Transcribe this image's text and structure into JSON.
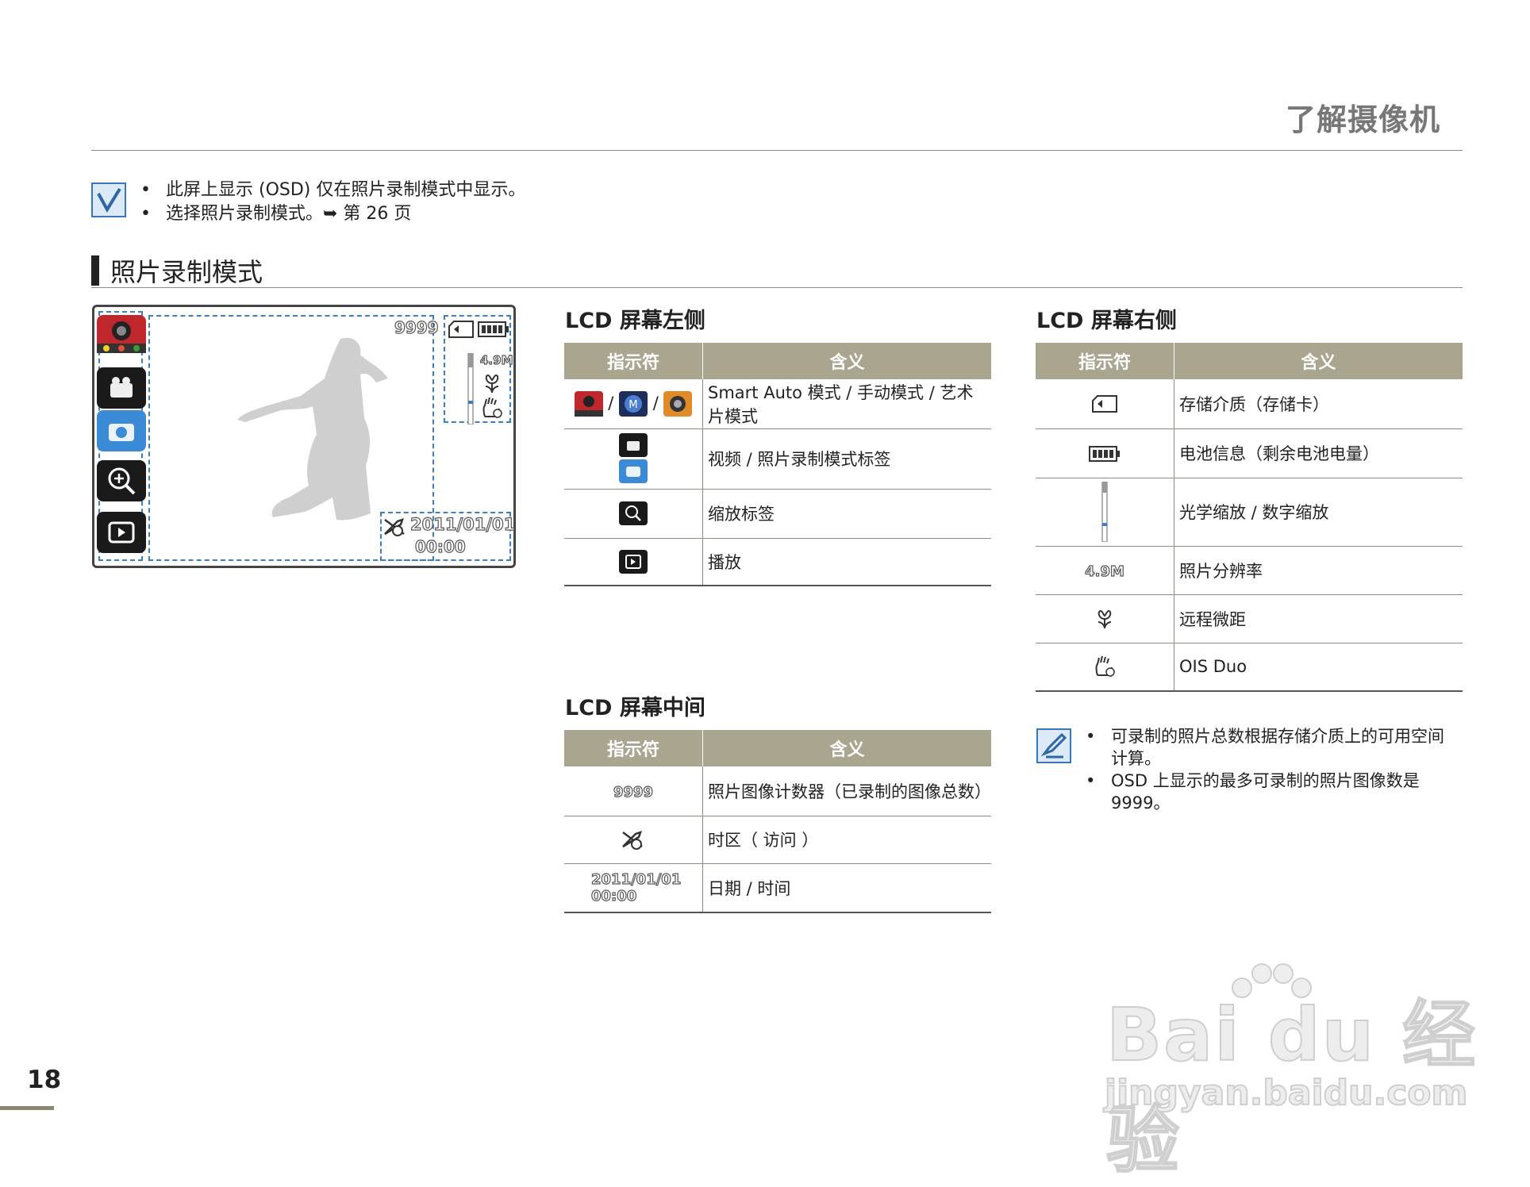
{
  "chapter_title": "了解摄像机",
  "notes": [
    "此屏上显示 (OSD) 仅在照片录制模式中显示。",
    "选择照片录制模式。➥ 第 26 页"
  ],
  "section_title": "照片录制模式",
  "lcd_preview": {
    "counter": "9999",
    "resolution": "4.9M",
    "date": "2011/01/01",
    "time": "00:00"
  },
  "left_table": {
    "title": "LCD 屏幕左侧",
    "col_indicator": "指示符",
    "col_meaning": "含义",
    "rows": [
      {
        "meaning": "Smart Auto 模式 / 手动模式 / 艺术片模式",
        "sep": "/"
      },
      {
        "meaning": "视频 / 照片录制模式标签"
      },
      {
        "meaning": "缩放标签"
      },
      {
        "meaning": "播放"
      }
    ]
  },
  "middle_table": {
    "title": "LCD 屏幕中间",
    "col_indicator": "指示符",
    "col_meaning": "含义",
    "rows": [
      {
        "indicator": "9999",
        "meaning": "照片图像计数器（已录制的图像总数）"
      },
      {
        "meaning": "时区（ 访问 ）"
      },
      {
        "indicator_date": "2011/01/01",
        "indicator_time": "00:00",
        "meaning": "日期 / 时间"
      }
    ]
  },
  "right_table": {
    "title": "LCD 屏幕右侧",
    "col_indicator": "指示符",
    "col_meaning": "含义",
    "rows": [
      {
        "meaning": "存储介质（存储卡）"
      },
      {
        "meaning": "电池信息（剩余电池电量）"
      },
      {
        "meaning": "光学缩放 / 数字缩放"
      },
      {
        "indicator": "4.9M",
        "meaning": "照片分辨率"
      },
      {
        "meaning": "远程微距"
      },
      {
        "meaning": "OIS Duo"
      }
    ]
  },
  "tips": [
    "可录制的照片总数根据存储介质上的可用空间计算。",
    "OSD 上显示的最多可录制的照片图像数是 9999。"
  ],
  "page_number": "18",
  "watermark": {
    "logo": "Bai du 经验",
    "url": "jingyan.baidu.com"
  },
  "colors": {
    "header_bg": "#a9a58f",
    "accent_blue": "#3b7fc4",
    "chapter_text": "#777777"
  }
}
